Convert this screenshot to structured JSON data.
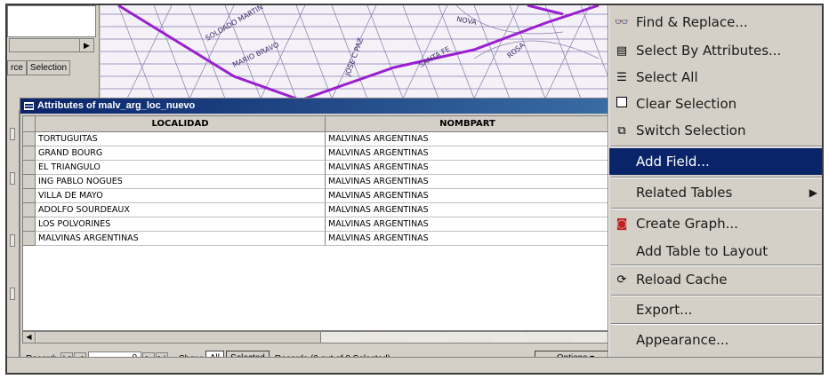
{
  "dock": {
    "tabs": [
      "rce",
      "Selection"
    ]
  },
  "map": {
    "street_labels": [
      "MARIO BRAVO",
      "SOLDADO MARTIN",
      "JOSE C PAZ",
      "NOVA",
      "SANTA FE",
      "ROSA"
    ]
  },
  "attributes_window": {
    "title": "Attributes of malv_arg_loc_nuevo",
    "columns": [
      "LOCALIDAD",
      "NOMBPART"
    ],
    "rows": [
      [
        "TORTUGUITAS",
        "MALVINAS ARGENTINAS"
      ],
      [
        "GRAND BOURG",
        "MALVINAS ARGENTINAS"
      ],
      [
        "EL TRIANGULO",
        "MALVINAS ARGENTINAS"
      ],
      [
        "ING PABLO NOGUES",
        "MALVINAS ARGENTINAS"
      ],
      [
        "VILLA DE MAYO",
        "MALVINAS ARGENTINAS"
      ],
      [
        "ADOLFO SOURDEAUX",
        "MALVINAS ARGENTINAS"
      ],
      [
        "LOS POLVORINES",
        "MALVINAS ARGENTINAS"
      ],
      [
        "MALVINAS ARGENTINAS",
        "MALVINAS ARGENTINAS"
      ]
    ],
    "status": {
      "record_label": "Record:",
      "record_value": "0",
      "show_label": "Show:",
      "all_label": "All",
      "selected_label": "Selected",
      "records_text": "Records (0 out of 8 Selected)",
      "options_label": "Options"
    }
  },
  "context_menu": {
    "items": [
      {
        "label": "Find & Replace...",
        "icon": "binoculars-icon"
      },
      {
        "label": "Select By Attributes...",
        "icon": "select-attributes-icon"
      },
      {
        "label": "Select All",
        "icon": "select-all-icon"
      },
      {
        "label": "Clear Selection",
        "icon": "clear-selection-icon"
      },
      {
        "label": "Switch Selection",
        "icon": "switch-selection-icon"
      },
      {
        "label": "Add Field...",
        "icon": "",
        "highlighted": true
      },
      {
        "label": "Related Tables",
        "icon": "",
        "submenu": true
      },
      {
        "label": "Create Graph...",
        "icon": "graph-icon"
      },
      {
        "label": "Add Table to Layout",
        "icon": ""
      },
      {
        "label": "Reload Cache",
        "icon": "reload-icon"
      },
      {
        "label": "Export...",
        "icon": ""
      },
      {
        "label": "Appearance...",
        "icon": ""
      }
    ]
  },
  "colors": {
    "highlight": "#0a246a",
    "road": "#9a1fd0",
    "window_bg": "#d4d0c8"
  }
}
